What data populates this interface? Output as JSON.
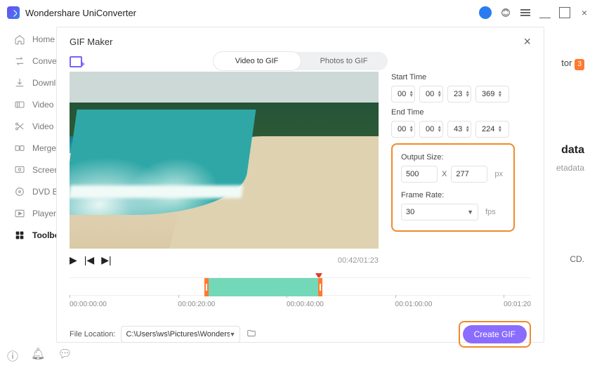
{
  "app": {
    "title": "Wondershare UniConverter"
  },
  "sidebar": {
    "items": [
      {
        "label": "Home"
      },
      {
        "label": "Converter"
      },
      {
        "label": "Downloader"
      },
      {
        "label": "Video Compressor"
      },
      {
        "label": "Video Editor"
      },
      {
        "label": "Merger"
      },
      {
        "label": "Screen Recorder"
      },
      {
        "label": "DVD Burner"
      },
      {
        "label": "Player"
      },
      {
        "label": "Toolbox"
      }
    ]
  },
  "bleed": {
    "line1": "tor",
    "big": "data",
    "sub": "etadata",
    "cd": "CD."
  },
  "modal": {
    "title": "GIF Maker",
    "tabs": {
      "video": "Video to GIF",
      "photos": "Photos to GIF"
    },
    "start_label": "Start Time",
    "end_label": "End Time",
    "start": {
      "h": "00",
      "m": "00",
      "s": "23",
      "ms": "369"
    },
    "end": {
      "h": "00",
      "m": "00",
      "s": "43",
      "ms": "224"
    },
    "output_label": "Output Size:",
    "output": {
      "w": "500",
      "h": "277",
      "unit": "px"
    },
    "rate_label": "Frame Rate:",
    "rate_value": "30",
    "rate_unit": "fps",
    "time_readout": "00:42/01:23",
    "ticks": [
      "00:00:00:00",
      "00:00:20:00",
      "00:00:40:00",
      "00:01:00:00",
      "00:01:20"
    ],
    "file_label": "File Location:",
    "file_path": "C:\\Users\\ws\\Pictures\\Wonders",
    "create_label": "Create GIF"
  }
}
